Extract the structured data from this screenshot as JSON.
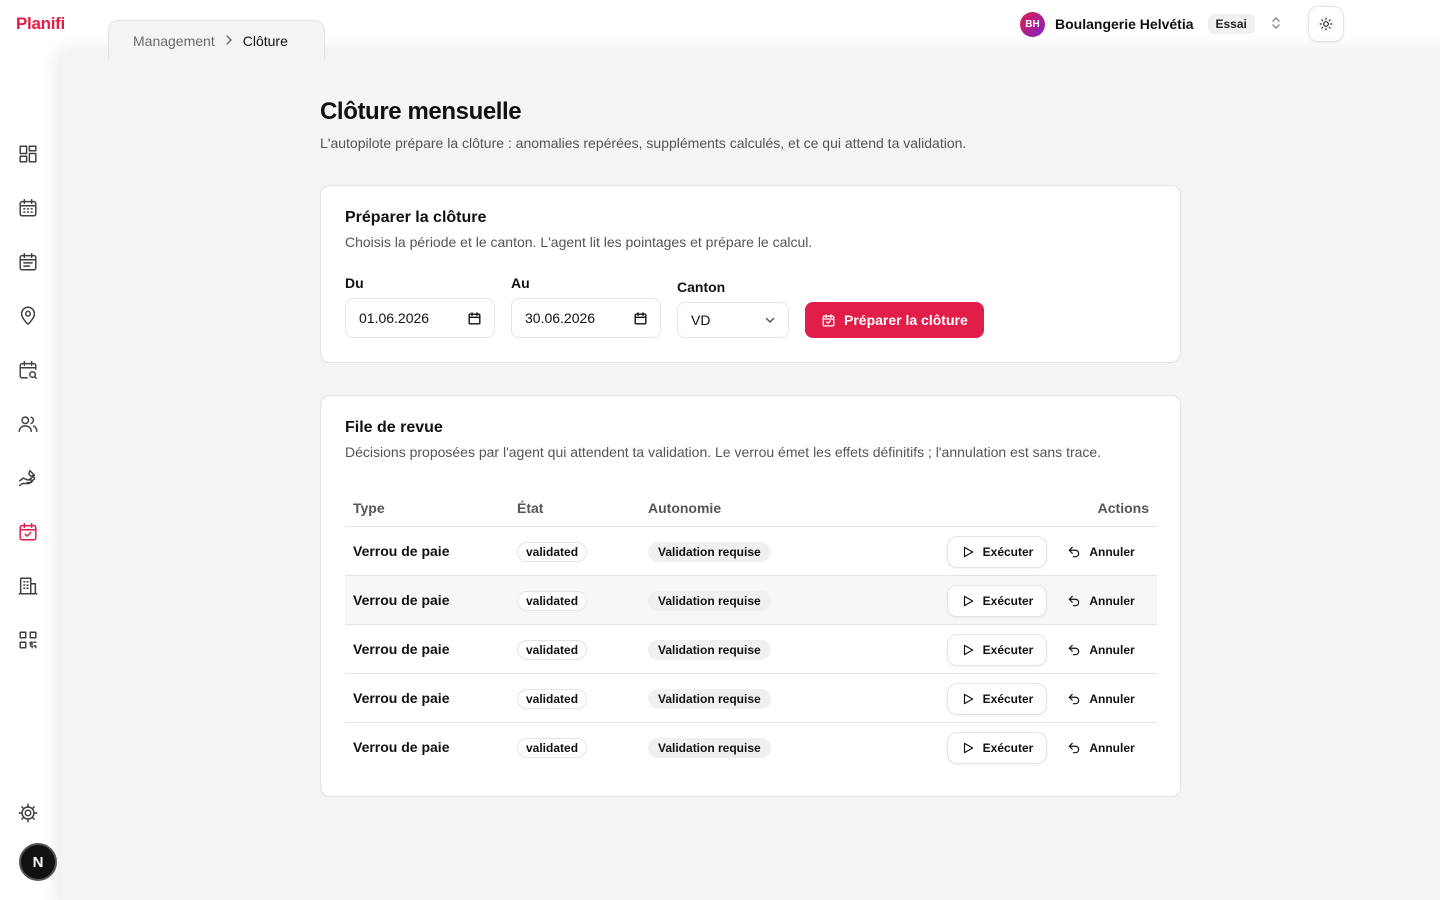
{
  "app": {
    "name": "Planifi"
  },
  "breadcrumb": {
    "parent": "Management",
    "current": "Clôture"
  },
  "org": {
    "initials": "BH",
    "name": "Boulangerie Helvétia",
    "plan": "Essai"
  },
  "user": {
    "initial": "N"
  },
  "page": {
    "title": "Clôture mensuelle",
    "subtitle": "L'autopilote prépare la clôture : anomalies repérées, suppléments calculés, et ce qui attend ta validation."
  },
  "prepare": {
    "title": "Préparer la clôture",
    "subtitle": "Choisis la période et le canton. L'agent lit les pointages et prépare le calcul.",
    "from_label": "Du",
    "from_value": "01.06.2026",
    "to_label": "Au",
    "to_value": "30.06.2026",
    "canton_label": "Canton",
    "canton_value": "VD",
    "button_label": "Préparer la clôture"
  },
  "review": {
    "title": "File de revue",
    "subtitle": "Décisions proposées par l'agent qui attendent ta validation. Le verrou émet les effets définitifs ; l'annulation est sans trace.",
    "columns": {
      "type": "Type",
      "state": "État",
      "autonomy": "Autonomie",
      "actions": "Actions"
    },
    "execute_label": "Exécuter",
    "cancel_label": "Annuler",
    "rows": [
      {
        "type": "Verrou de paie",
        "state": "validated",
        "autonomy": "Validation requise"
      },
      {
        "type": "Verrou de paie",
        "state": "validated",
        "autonomy": "Validation requise"
      },
      {
        "type": "Verrou de paie",
        "state": "validated",
        "autonomy": "Validation requise"
      },
      {
        "type": "Verrou de paie",
        "state": "validated",
        "autonomy": "Validation requise"
      },
      {
        "type": "Verrou de paie",
        "state": "validated",
        "autonomy": "Validation requise"
      }
    ]
  },
  "sidebar": {
    "items": [
      {
        "icon": "dashboard-icon"
      },
      {
        "icon": "calendar-grid-icon"
      },
      {
        "icon": "calendar-list-icon"
      },
      {
        "icon": "location-pin-icon"
      },
      {
        "icon": "calendar-search-icon"
      },
      {
        "icon": "users-icon"
      },
      {
        "icon": "hand-pay-icon"
      },
      {
        "icon": "calendar-check-icon",
        "active": true
      },
      {
        "icon": "building-icon"
      },
      {
        "icon": "qr-code-icon"
      }
    ],
    "settings_icon": "gear-icon"
  },
  "colors": {
    "accent": "#e11d48",
    "panel_bg": "#f4f4f4",
    "border": "#e4e4e7"
  }
}
